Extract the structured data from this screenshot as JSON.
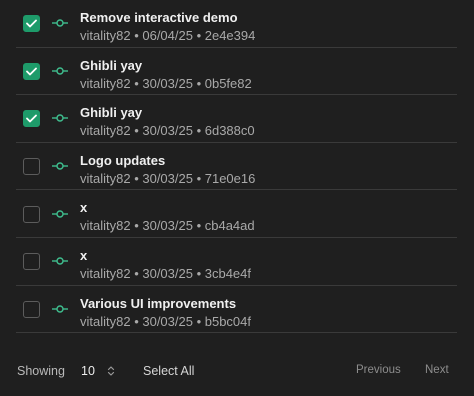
{
  "colors": {
    "background": "#1f1f1f",
    "accent": "#1e9b6a",
    "commit_icon": "#3fbf8f",
    "divider": "#3a3a3a"
  },
  "commits": [
    {
      "title": "Remove interactive demo",
      "author": "vitality82",
      "date": "06/04/25",
      "hash": "2e4e394",
      "selected": true,
      "meta": "vitality82 • 06/04/25 • 2e4e394"
    },
    {
      "title": "Ghibli yay",
      "author": "vitality82",
      "date": "30/03/25",
      "hash": "0b5fe82",
      "selected": true,
      "meta": "vitality82 • 30/03/25 • 0b5fe82"
    },
    {
      "title": "Ghibli yay",
      "author": "vitality82",
      "date": "30/03/25",
      "hash": "6d388c0",
      "selected": true,
      "meta": "vitality82 • 30/03/25 • 6d388c0"
    },
    {
      "title": "Logo updates",
      "author": "vitality82",
      "date": "30/03/25",
      "hash": "71e0e16",
      "selected": false,
      "meta": "vitality82 • 30/03/25 • 71e0e16"
    },
    {
      "title": "x",
      "author": "vitality82",
      "date": "30/03/25",
      "hash": "cb4a4ad",
      "selected": false,
      "meta": "vitality82 • 30/03/25 • cb4a4ad"
    },
    {
      "title": "x",
      "author": "vitality82",
      "date": "30/03/25",
      "hash": "3cb4e4f",
      "selected": false,
      "meta": "vitality82 • 30/03/25 • 3cb4e4f"
    },
    {
      "title": "Various UI improvements",
      "author": "vitality82",
      "date": "30/03/25",
      "hash": "b5bc04f",
      "selected": false,
      "meta": "vitality82 • 30/03/25 • b5bc04f"
    }
  ],
  "footer": {
    "showing_label": "Showing",
    "page_size": "10",
    "select_all_label": "Select All",
    "previous_label": "Previous",
    "next_label": "Next"
  }
}
